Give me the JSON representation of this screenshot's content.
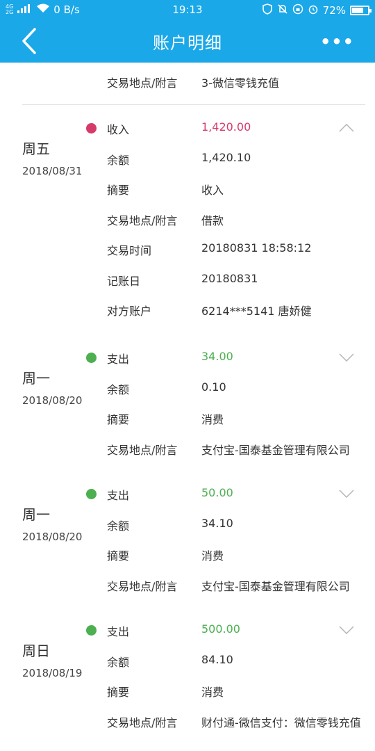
{
  "status": {
    "net": "4G",
    "net2": "2G",
    "speed": "0 B/s",
    "time": "19:13",
    "battery": "72%",
    "battery_level": 0.72
  },
  "header": {
    "title": "账户明细",
    "more": "•••"
  },
  "prev": {
    "key": "交易地点/附言",
    "value": "3-微信零钱充值"
  },
  "colors": {
    "income": "#d63a6a",
    "expense": "#4caf50",
    "accent": "#1aa8e8"
  },
  "entries": [
    {
      "day": "周五",
      "date": "2018/08/31",
      "type": "收入",
      "amount": "1,420.00",
      "kind": "income",
      "expanded": true,
      "rows": [
        {
          "k": "余额",
          "v": "1,420.10"
        },
        {
          "k": "摘要",
          "v": "收入"
        },
        {
          "k": "交易地点/附言",
          "v": "借款"
        },
        {
          "k": "交易时间",
          "v": "20180831 18:58:12"
        },
        {
          "k": "记账日",
          "v": "20180831"
        },
        {
          "k": "对方账户",
          "v": "6214***5141 唐娇健"
        }
      ]
    },
    {
      "day": "周一",
      "date": "2018/08/20",
      "type": "支出",
      "amount": "34.00",
      "kind": "expense",
      "expanded": false,
      "rows": [
        {
          "k": "余额",
          "v": "0.10"
        },
        {
          "k": "摘要",
          "v": "消费"
        },
        {
          "k": "交易地点/附言",
          "v": "支付宝-国泰基金管理有限公司"
        }
      ]
    },
    {
      "day": "周一",
      "date": "2018/08/20",
      "type": "支出",
      "amount": "50.00",
      "kind": "expense",
      "expanded": false,
      "rows": [
        {
          "k": "余额",
          "v": "34.10"
        },
        {
          "k": "摘要",
          "v": "消费"
        },
        {
          "k": "交易地点/附言",
          "v": "支付宝-国泰基金管理有限公司"
        }
      ]
    },
    {
      "day": "周日",
      "date": "2018/08/19",
      "type": "支出",
      "amount": "500.00",
      "kind": "expense",
      "expanded": false,
      "rows": [
        {
          "k": "余额",
          "v": "84.10"
        },
        {
          "k": "摘要",
          "v": "消费"
        },
        {
          "k": "交易地点/附言",
          "v": "财付通-微信支付：微信零钱充值"
        }
      ]
    }
  ]
}
